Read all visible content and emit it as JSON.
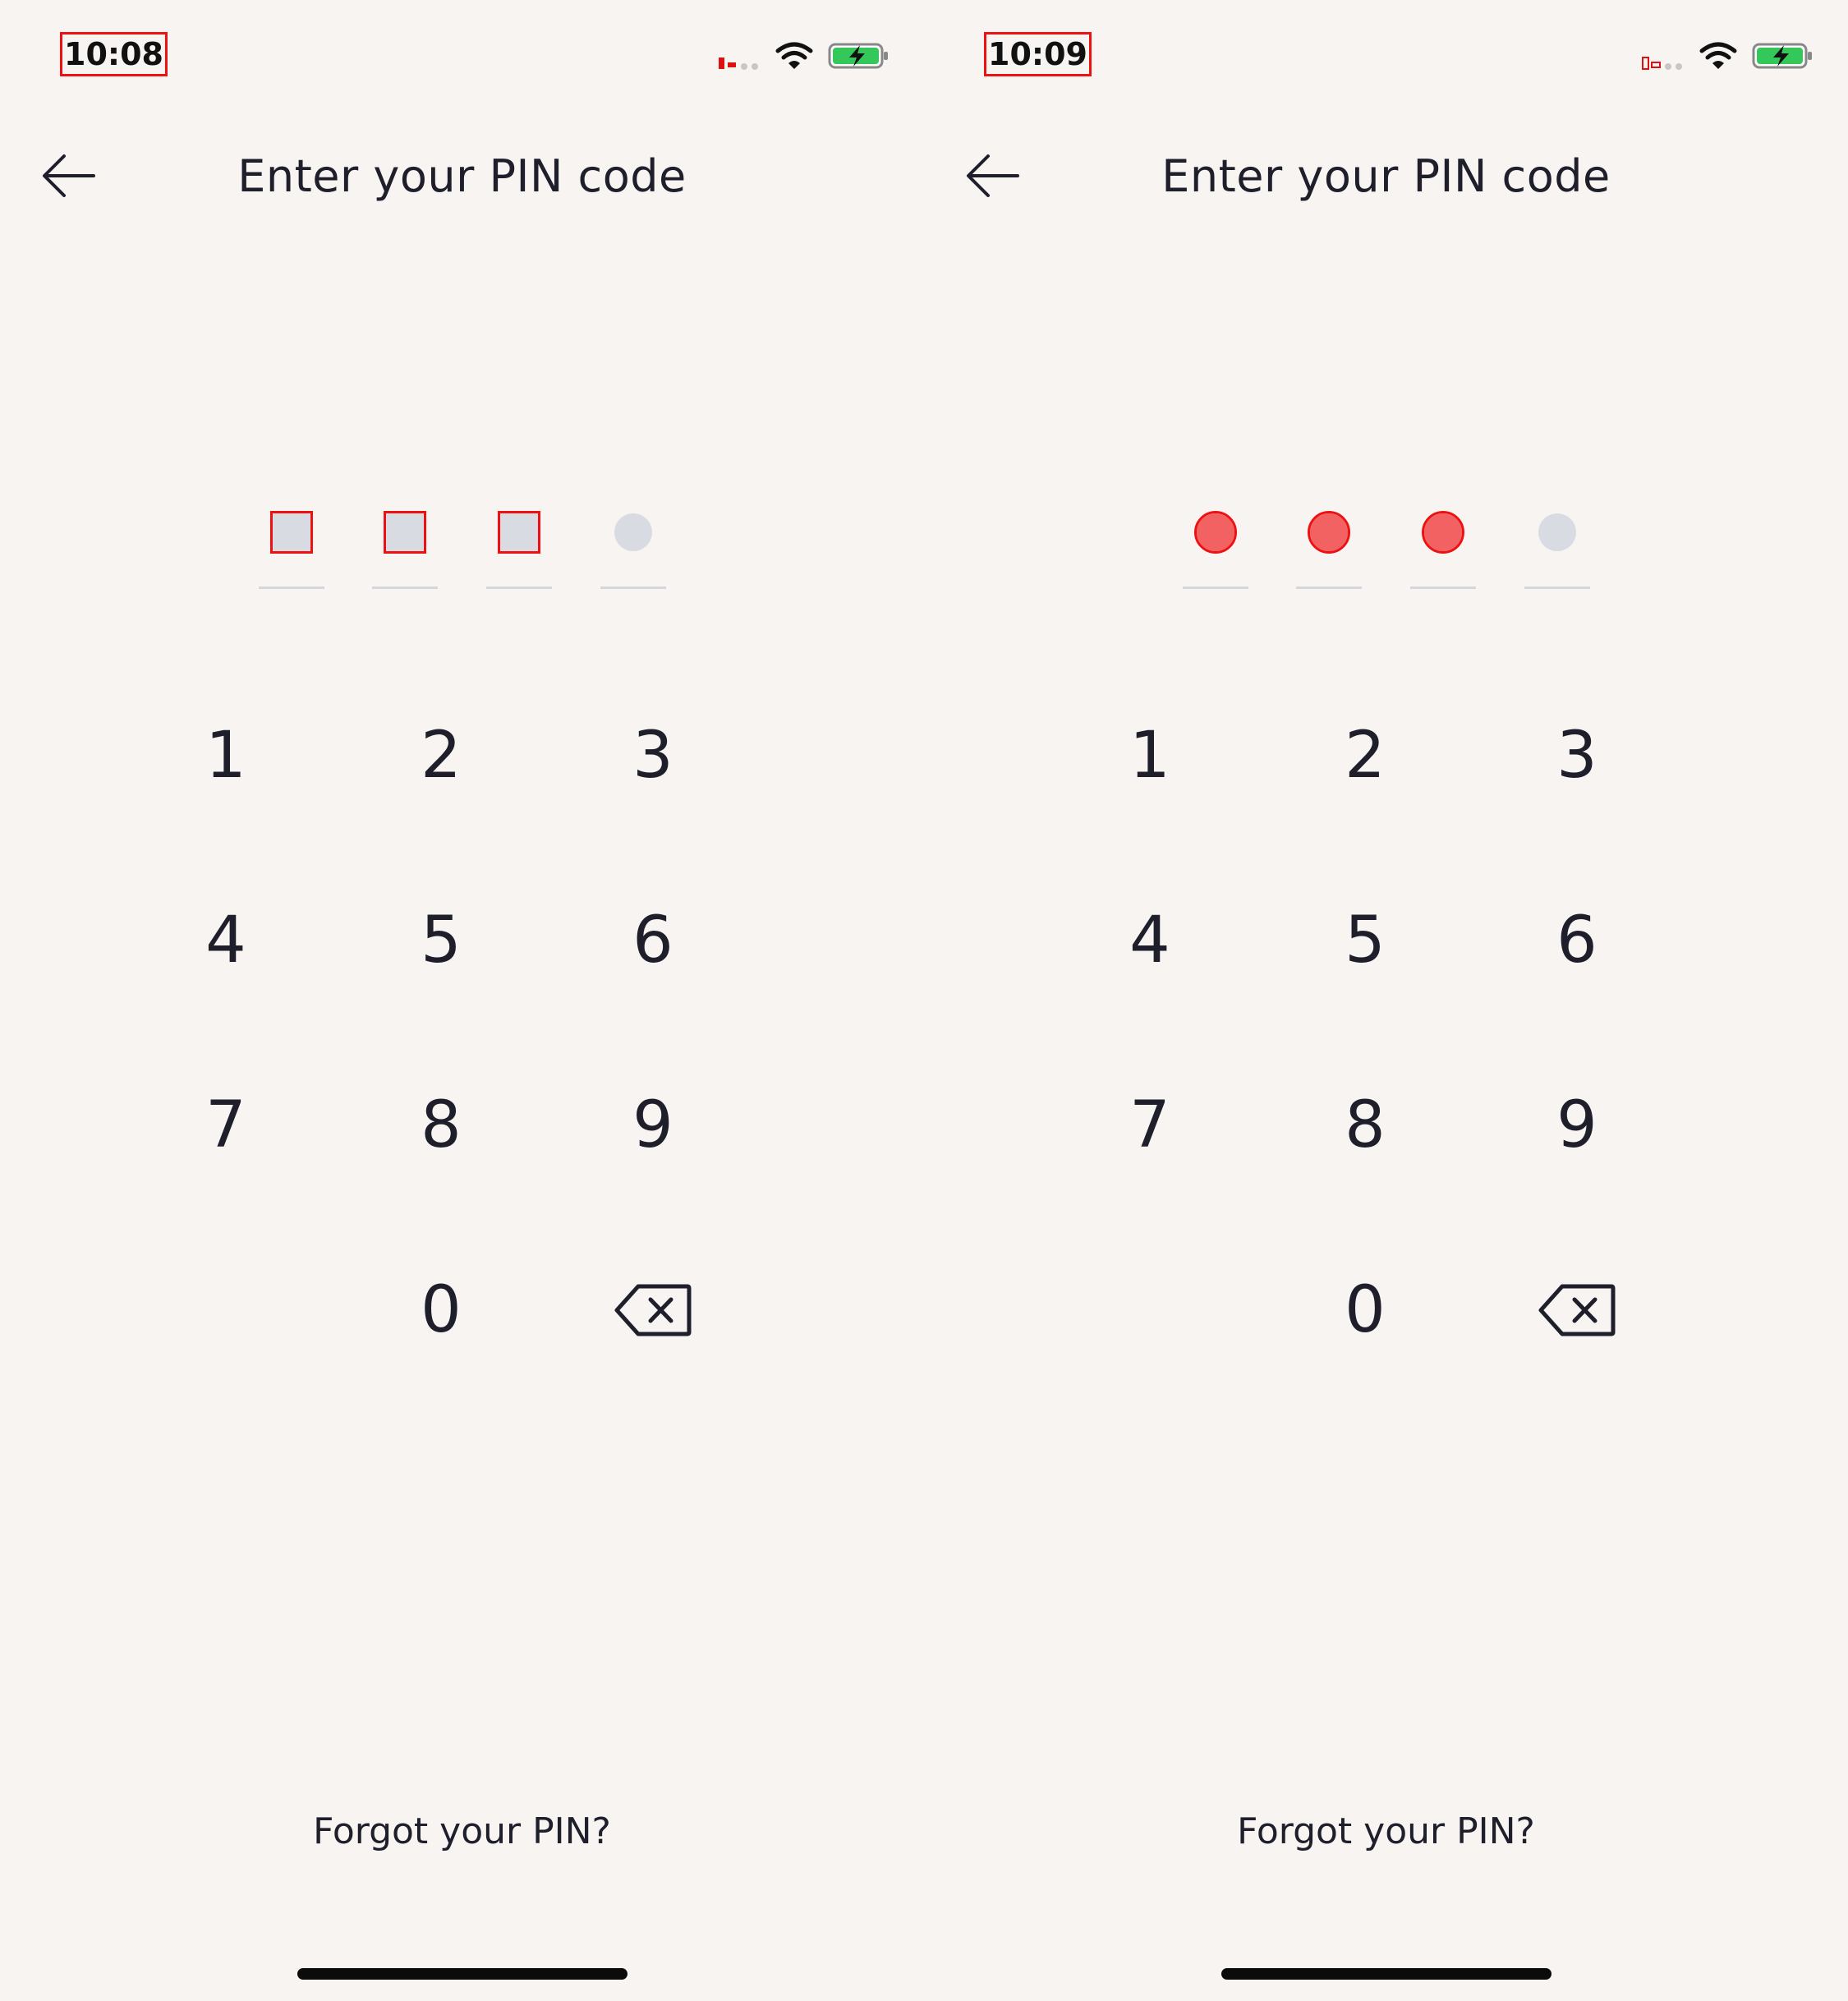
{
  "screens": [
    {
      "status": {
        "time": "10:08"
      },
      "header": {
        "title": "Enter your PIN code",
        "back_icon": "arrow-left-icon"
      },
      "pin": {
        "length": 4,
        "entered": 3,
        "state": "neutral"
      },
      "keypad": {
        "keys": [
          "1",
          "2",
          "3",
          "4",
          "5",
          "6",
          "7",
          "8",
          "9",
          "0"
        ],
        "delete_icon": "backspace-icon"
      },
      "forgot_link": "Forgot your PIN?"
    },
    {
      "status": {
        "time": "10:09"
      },
      "header": {
        "title": "Enter your PIN code",
        "back_icon": "arrow-left-icon"
      },
      "pin": {
        "length": 4,
        "entered": 3,
        "state": "error"
      },
      "keypad": {
        "keys": [
          "1",
          "2",
          "3",
          "4",
          "5",
          "6",
          "7",
          "8",
          "9",
          "0"
        ],
        "delete_icon": "backspace-icon"
      },
      "forgot_link": "Forgot your PIN?"
    }
  ],
  "colors": {
    "background": "#f7f4f1",
    "text": "#1e1f2b",
    "pin_empty": "#d9dbe2",
    "pin_error": "#f26262",
    "battery_fill": "#34c759"
  }
}
